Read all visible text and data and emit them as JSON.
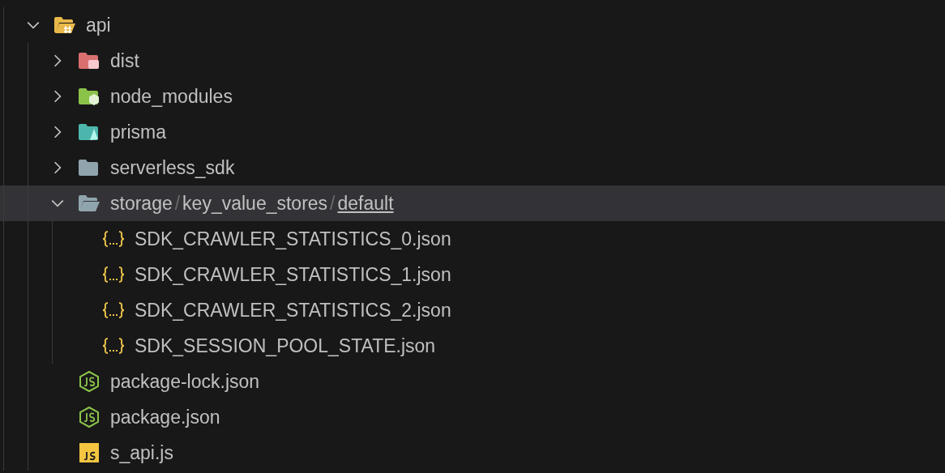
{
  "tree": [
    {
      "label": "api",
      "kind": "folder-api",
      "expanded": true,
      "selected": false,
      "children": [
        {
          "label": "dist",
          "kind": "folder-dist",
          "expanded": false,
          "selected": false
        },
        {
          "label": "node_modules",
          "kind": "folder-node",
          "expanded": false,
          "selected": false
        },
        {
          "label": "prisma",
          "kind": "folder-prisma",
          "expanded": false,
          "selected": false
        },
        {
          "label": "serverless_sdk",
          "kind": "folder",
          "expanded": false,
          "selected": false
        },
        {
          "parts": [
            {
              "text": "storage",
              "kind": "name"
            },
            {
              "text": "/",
              "kind": "separator"
            },
            {
              "text": "key_value_stores",
              "kind": "name"
            },
            {
              "text": "/",
              "kind": "separator"
            },
            {
              "text": "default",
              "kind": "focused"
            }
          ],
          "kind": "folder",
          "expanded": true,
          "selected": true,
          "children": [
            {
              "label": "SDK_CRAWLER_STATISTICS_0.json",
              "kind": "json",
              "selected": false
            },
            {
              "label": "SDK_CRAWLER_STATISTICS_1.json",
              "kind": "json",
              "selected": false
            },
            {
              "label": "SDK_CRAWLER_STATISTICS_2.json",
              "kind": "json",
              "selected": false
            },
            {
              "label": "SDK_SESSION_POOL_STATE.json",
              "kind": "json",
              "selected": false
            }
          ]
        },
        {
          "label": "package-lock.json",
          "kind": "node-json",
          "selected": false
        },
        {
          "label": "package.json",
          "kind": "node-json",
          "selected": false
        },
        {
          "label": "s_api.js",
          "kind": "js",
          "selected": false
        }
      ]
    }
  ]
}
